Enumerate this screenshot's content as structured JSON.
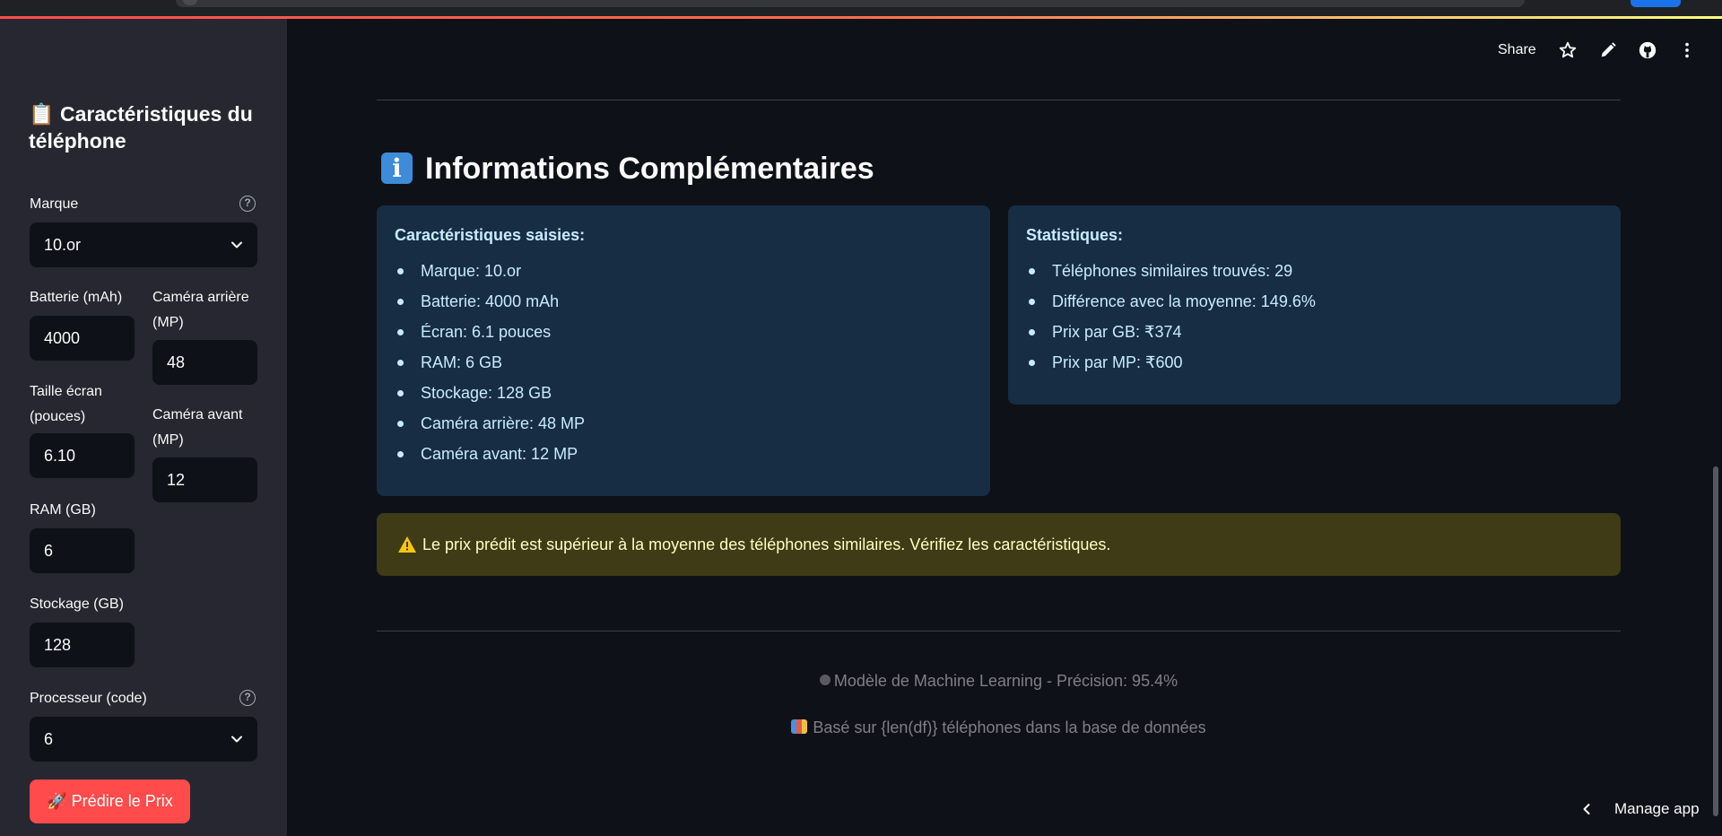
{
  "sidebar": {
    "title_emoji": "📋",
    "title": "Caractéristiques du téléphone",
    "brand_label": "Marque",
    "brand_value": "10.or",
    "battery_label": "Batterie (mAh)",
    "battery_value": "4000",
    "rear_camera_label": "Caméra arrière (MP)",
    "rear_camera_value": "48",
    "screen_label": "Taille écran (pouces)",
    "screen_value": "6.10",
    "front_camera_label": "Caméra avant (MP)",
    "front_camera_value": "12",
    "ram_label": "RAM (GB)",
    "ram_value": "6",
    "storage_label": "Stockage (GB)",
    "storage_value": "128",
    "processor_label": "Processeur (code)",
    "processor_value": "6",
    "help_glyph": "?",
    "predict_button": "🚀 Prédire le Prix"
  },
  "toolbar": {
    "share_label": "Share",
    "icons": [
      "star-icon",
      "pencil-icon",
      "github-icon",
      "more-vertical-icon"
    ]
  },
  "main": {
    "heading_icon": "i",
    "heading": "Informations Complémentaires",
    "entered_card": {
      "title": "Caractéristiques saisies:",
      "items": [
        "Marque: 10.or",
        "Batterie: 4000 mAh",
        "Écran: 6.1 pouces",
        "RAM: 6 GB",
        "Stockage: 128 GB",
        "Caméra arrière: 48 MP",
        "Caméra avant: 12 MP"
      ]
    },
    "stats_card": {
      "title": "Statistiques:",
      "items": [
        "Téléphones similaires trouvés: 29",
        "Différence avec la moyenne: 149.6%",
        "Prix par GB: ₹374",
        "Prix par MP: ₹600"
      ]
    },
    "warning": "Le prix prédit est supérieur à la moyenne des téléphones similaires. Vérifiez les caractéristiques.",
    "footer_model": "Modèle de Machine Learning - Précision: 95.4%",
    "footer_database": "Basé sur {len(df)} téléphones dans la base de données"
  },
  "manage_app": "Manage app",
  "colors": {
    "accent": "#ff4b4b",
    "info_bg": "#172d43",
    "warning_bg": "#3e3b16",
    "sidebar_bg": "#262730",
    "main_bg": "#0e1117"
  }
}
